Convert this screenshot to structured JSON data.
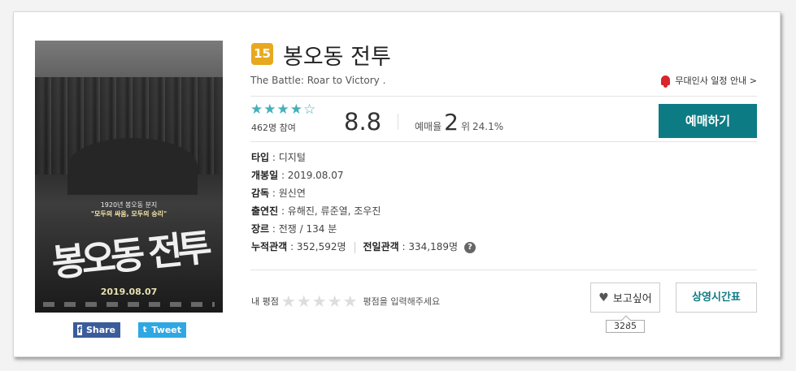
{
  "movie": {
    "age_rating": "15",
    "title": "봉오동 전투",
    "original_title": "The Battle: Roar to Victory .",
    "stage_greeting_link": "무대인사 일정 안내 >",
    "stars_display": "★★★★☆",
    "rating_fraction": 0.88,
    "participants": "462명 참여",
    "score": "8.8",
    "reservation": {
      "label_prefix": "예매율",
      "rank": "2",
      "rank_suffix": "위",
      "rate": "24.1%"
    },
    "reserve_button": "예매하기",
    "info": {
      "type_label": "타입",
      "type_value": "디지털",
      "release_label": "개봉일",
      "release_value": "2019.08.07",
      "director_label": "감독",
      "director_value": "원신연",
      "cast_label": "출연진",
      "cast_value": "유해진, 류준열, 조우진",
      "genre_label": "장르",
      "genre_value": "전쟁 / 134 분",
      "cumulative_label": "누적관객",
      "cumulative_value": "352,592명",
      "previous_day_label": "전일관객",
      "previous_day_value": "334,189명",
      "help_symbol": "?"
    },
    "my_rating": {
      "label": "내 평점",
      "stars_display": "★★★★★",
      "hint": "평점을 입력해주세요"
    },
    "want_button": "보고싶어",
    "want_count": "3285",
    "schedule_button": "상영시간표"
  },
  "poster": {
    "tagline_small": "1920년 봉오동 분지",
    "tagline_main": "\"모두의 싸움, 모두의 승리\"",
    "calligraphy_title": "봉오동 전투",
    "date": "2019.08.07"
  },
  "share": {
    "facebook_icon": "f",
    "facebook_label": "Share",
    "twitter_icon": "t",
    "twitter_label": "Tweet"
  },
  "colors": {
    "accent": "#0d7b83",
    "star": "#45b0ba",
    "age_badge": "#e8a91e",
    "facebook": "#3b5c9a",
    "twitter": "#2fa7e3",
    "bell": "#d9252c"
  }
}
